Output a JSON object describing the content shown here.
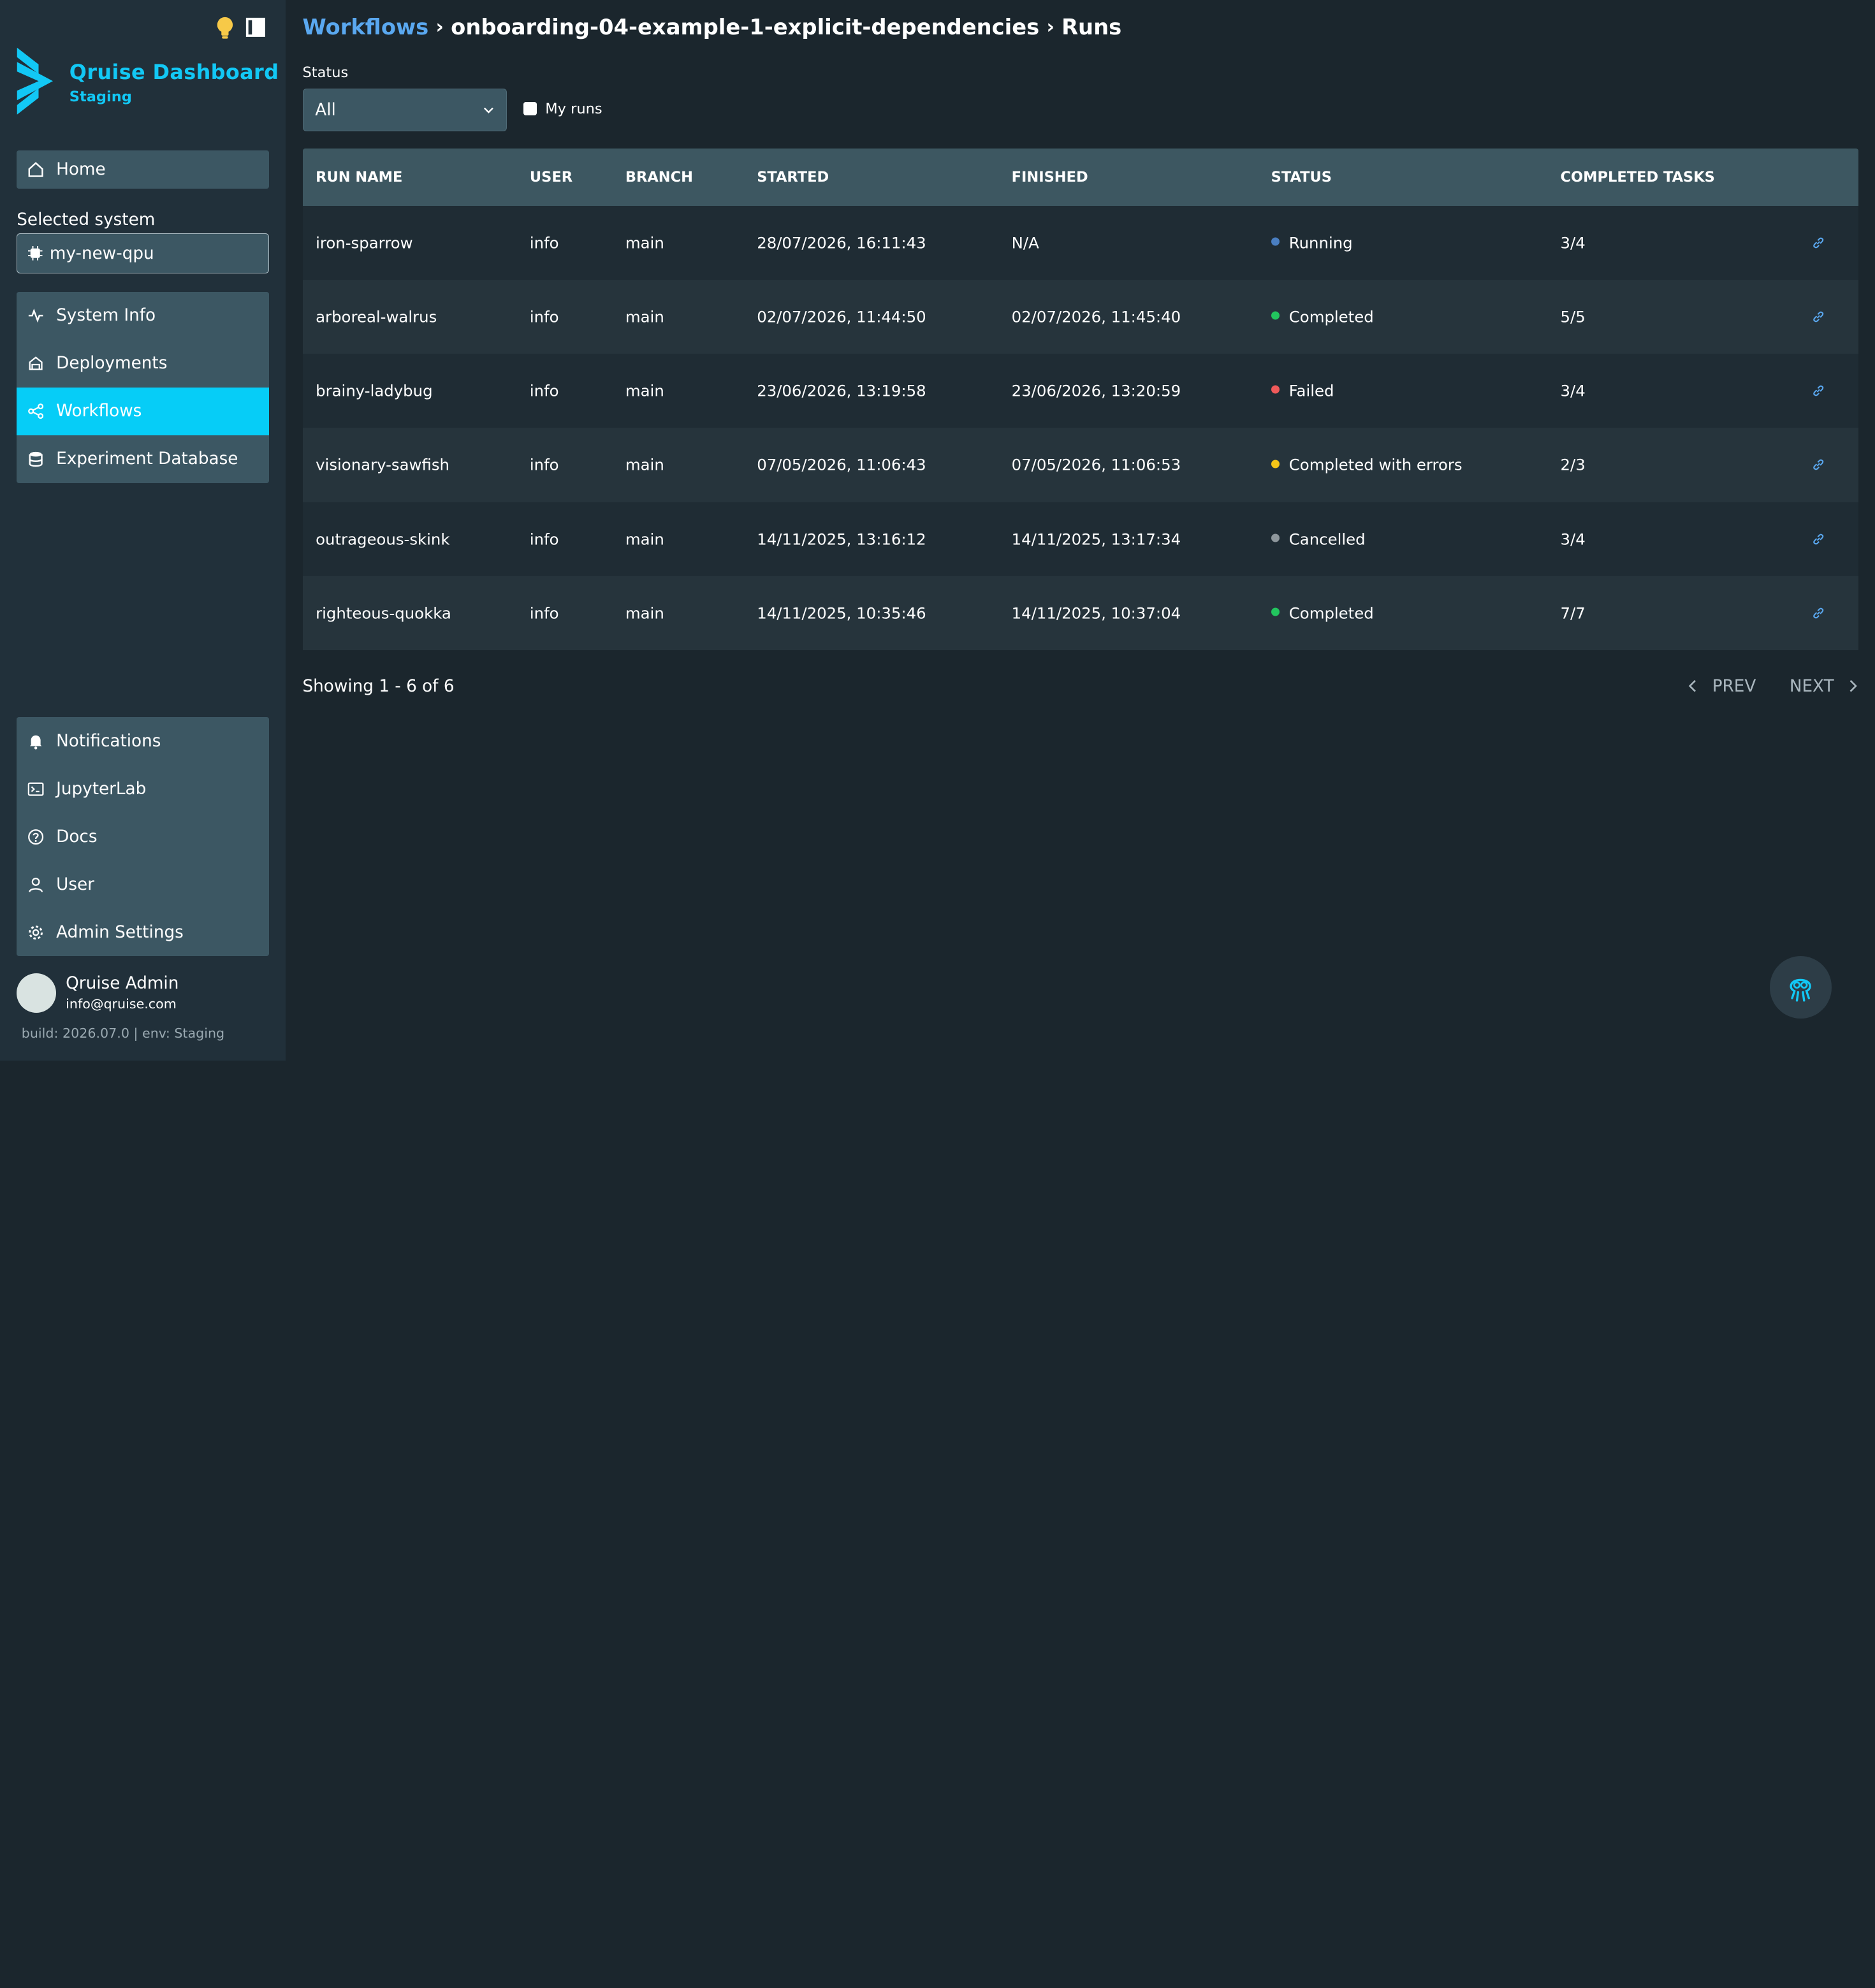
{
  "brand": {
    "title": "Qruise Dashboard",
    "subtitle": "Staging"
  },
  "sidebar": {
    "home": "Home",
    "selected_system_label": "Selected system",
    "selected_system": "my-new-qpu",
    "items": [
      {
        "label": "System Info",
        "icon": "activity-icon"
      },
      {
        "label": "Deployments",
        "icon": "deployments-icon"
      },
      {
        "label": "Workflows",
        "icon": "workflow-icon"
      },
      {
        "label": "Experiment Database",
        "icon": "database-icon"
      }
    ],
    "bottom_items": [
      {
        "label": "Notifications",
        "icon": "bell-icon"
      },
      {
        "label": "JupyterLab",
        "icon": "terminal-icon"
      },
      {
        "label": "Docs",
        "icon": "help-icon"
      },
      {
        "label": "User",
        "icon": "user-icon"
      },
      {
        "label": "Admin Settings",
        "icon": "gear-icon"
      }
    ],
    "user_name": "Qruise Admin",
    "user_email": "info@qruise.com",
    "build": "build: 2026.07.0 | env: Staging"
  },
  "breadcrumb": {
    "root": "Workflows",
    "workflow": "onboarding-04-example-1-explicit-dependencies",
    "page": "Runs"
  },
  "filters": {
    "status_label": "Status",
    "status_value": "All",
    "my_runs": "My runs"
  },
  "table": {
    "headers": [
      "RUN NAME",
      "USER",
      "BRANCH",
      "STARTED",
      "FINISHED",
      "STATUS",
      "COMPLETED TASKS"
    ],
    "rows": [
      {
        "name": "iron-sparrow",
        "user": "info",
        "branch": "main",
        "started": "28/07/2026, 16:11:43",
        "finished": "N/A",
        "status": "Running",
        "tasks": "3/4"
      },
      {
        "name": "arboreal-walrus",
        "user": "info",
        "branch": "main",
        "started": "02/07/2026, 11:44:50",
        "finished": "02/07/2026, 11:45:40",
        "status": "Completed",
        "tasks": "5/5"
      },
      {
        "name": "brainy-ladybug",
        "user": "info",
        "branch": "main",
        "started": "23/06/2026, 13:19:58",
        "finished": "23/06/2026, 13:20:59",
        "status": "Failed",
        "tasks": "3/4"
      },
      {
        "name": "visionary-sawfish",
        "user": "info",
        "branch": "main",
        "started": "07/05/2026, 11:06:43",
        "finished": "07/05/2026, 11:06:53",
        "status": "Completed with errors",
        "tasks": "2/3"
      },
      {
        "name": "outrageous-skink",
        "user": "info",
        "branch": "main",
        "started": "14/11/2025, 13:16:12",
        "finished": "14/11/2025, 13:17:34",
        "status": "Cancelled",
        "tasks": "3/4"
      },
      {
        "name": "righteous-quokka",
        "user": "info",
        "branch": "main",
        "started": "14/11/2025, 10:35:46",
        "finished": "14/11/2025, 10:37:04",
        "status": "Completed",
        "tasks": "7/7"
      }
    ]
  },
  "status_colors": {
    "Running": "#4a7fc1",
    "Completed": "#22c55e",
    "Failed": "#ef5a5a",
    "Completed with errors": "#f5c518",
    "Cancelled": "#8e979c"
  },
  "pagination": {
    "showing": "Showing 1 - 6 of 6",
    "prev": "PREV",
    "next": "NEXT"
  }
}
